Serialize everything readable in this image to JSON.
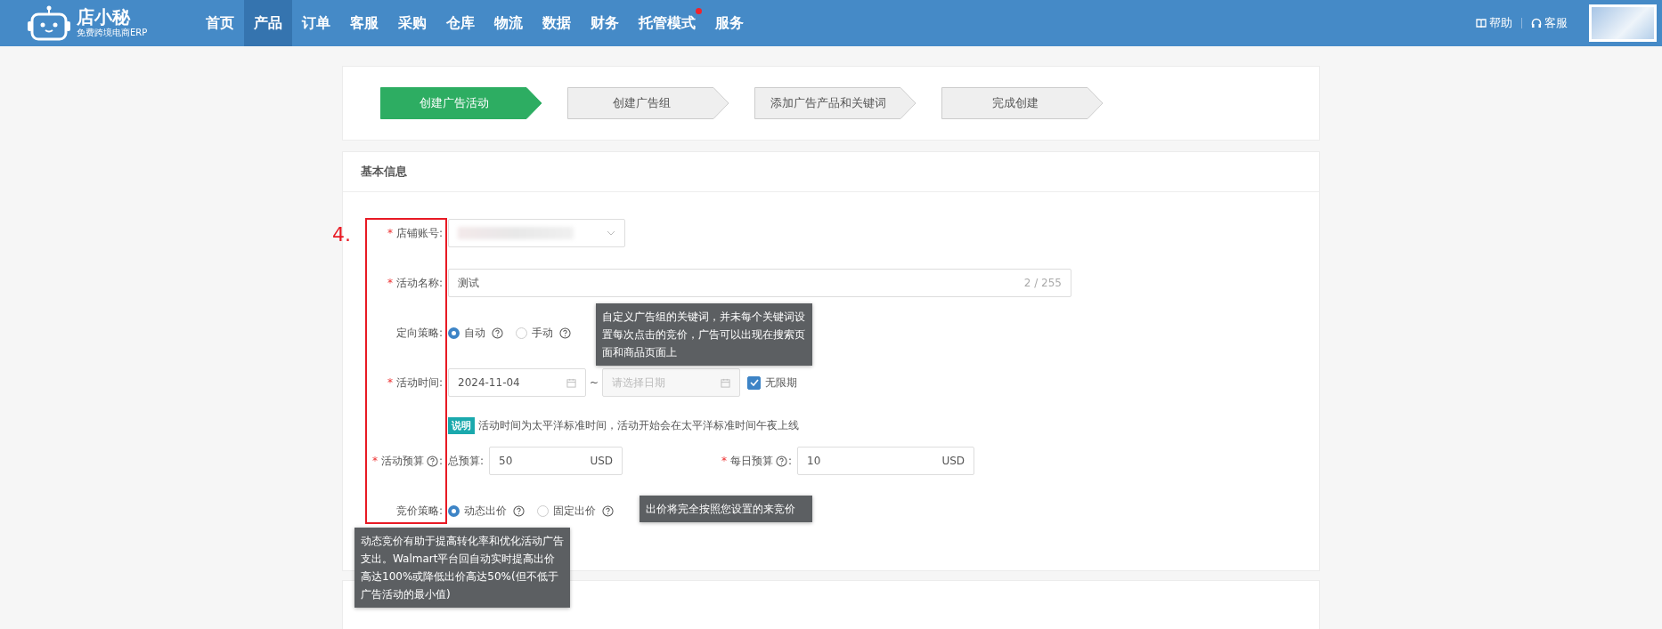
{
  "header": {
    "logo_text": "店小秘",
    "logo_subtext": "免费跨境电商ERP",
    "nav": [
      {
        "label": "首页",
        "selected": false,
        "dot": false
      },
      {
        "label": "产品",
        "selected": true,
        "dot": false
      },
      {
        "label": "订单",
        "selected": false,
        "dot": false
      },
      {
        "label": "客服",
        "selected": false,
        "dot": false
      },
      {
        "label": "采购",
        "selected": false,
        "dot": false
      },
      {
        "label": "仓库",
        "selected": false,
        "dot": false
      },
      {
        "label": "物流",
        "selected": false,
        "dot": false
      },
      {
        "label": "数据",
        "selected": false,
        "dot": false
      },
      {
        "label": "财务",
        "selected": false,
        "dot": false
      },
      {
        "label": "托管模式",
        "selected": false,
        "dot": true
      },
      {
        "label": "服务",
        "selected": false,
        "dot": false
      }
    ],
    "links": [
      {
        "label": "帮助",
        "kind": "book"
      },
      {
        "label": "客服",
        "kind": "headset"
      }
    ]
  },
  "steps": [
    {
      "label": "创建广告活动",
      "selected": true
    },
    {
      "label": "创建广告组",
      "selected": false
    },
    {
      "label": "添加广告产品和关键词",
      "selected": false
    },
    {
      "label": "完成创建",
      "selected": false
    }
  ],
  "section": {
    "title": "基本信息",
    "annotation": "4.",
    "rows": [
      {
        "kind": "select",
        "required_mark": "*",
        "label": "店铺账号:"
      },
      {
        "kind": "text",
        "required_mark": "*",
        "label": "活动名称:",
        "value": "测试",
        "counter": "2 / 255"
      },
      {
        "kind": "radio",
        "label": "定向策略:",
        "options": [
          {
            "label": "自动",
            "selected": true
          },
          {
            "label": "手动",
            "selected": false
          }
        ]
      },
      {
        "kind": "dates",
        "required_mark": "*",
        "label": "活动时间:",
        "start": "2024-11-04",
        "range_separator": "~",
        "end_placeholder": "请选择日期",
        "unlimited": {
          "label": "无限期",
          "checked": true
        }
      },
      {
        "kind": "note",
        "tag": "说明",
        "text": "活动时间为太平洋标准时间，活动开始会在太平洋标准时间午夜上线"
      },
      {
        "kind": "budget",
        "required_mark": "*",
        "label": "活动预算",
        "colon": ":",
        "total_label": "总预算:",
        "total_value": "50",
        "total_unit": "USD",
        "daily_required_mark": "*",
        "daily_label": "每日预算",
        "daily_colon": ":",
        "daily_value": "10",
        "daily_unit": "USD"
      },
      {
        "kind": "radio",
        "label": "竞价策略:",
        "options": [
          {
            "label": "动态出价",
            "selected": true
          },
          {
            "label": "固定出价",
            "selected": false
          }
        ]
      }
    ]
  },
  "tooltips": [
    {
      "text": "自定义广告组的关键词，并未每个关键词设置每次点击的竞价，广告可以出现在搜索页面和商品页面上"
    },
    {
      "text": "出价将完全按照您设置的来竞价"
    },
    {
      "text": "动态竞价有助于提高转化率和优化活动广告支出。Walmart平台回自动实时提高出价高达100%或降低出价高达50%(但不低于广告活动的最小值)"
    }
  ]
}
